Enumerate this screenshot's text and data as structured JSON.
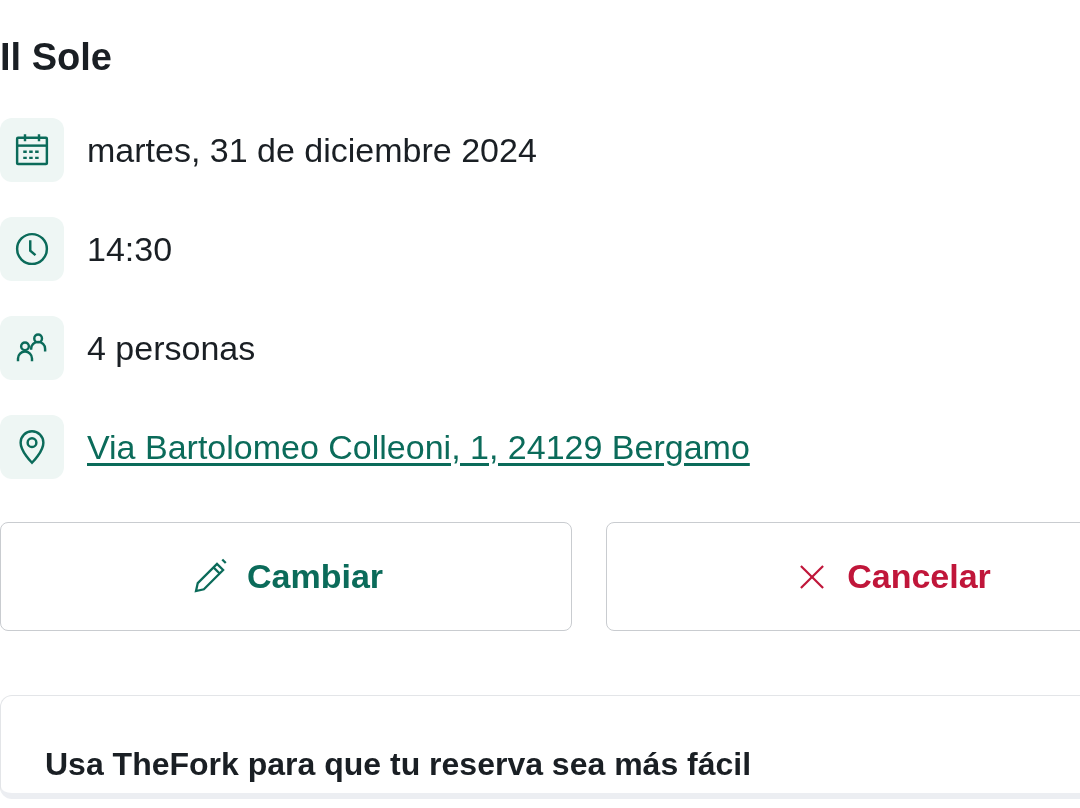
{
  "restaurant": {
    "name": "Il Sole"
  },
  "details": [
    {
      "kind": "date",
      "text": "martes, 31 de diciembre 2024"
    },
    {
      "kind": "time",
      "text": "14:30"
    },
    {
      "kind": "guests",
      "text": "4 personas"
    },
    {
      "kind": "address",
      "text": "Via Bartolomeo Colleoni, 1, 24129 Bergamo"
    }
  ],
  "buttons": [
    {
      "kind": "edit",
      "label": "Cambiar"
    },
    {
      "kind": "cancel",
      "label": "Cancelar"
    }
  ],
  "promo": {
    "title": "Usa TheFork para que tu reserva sea más fácil"
  }
}
